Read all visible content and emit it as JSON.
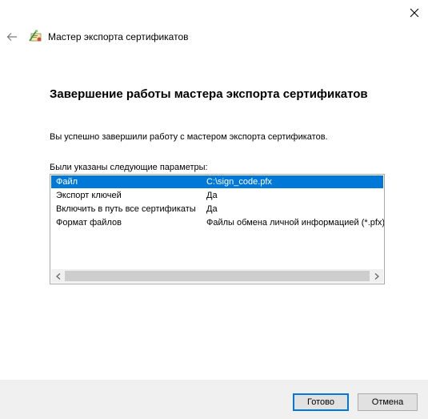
{
  "window": {
    "title": "Мастер экспорта сертификатов"
  },
  "page": {
    "heading": "Завершение работы мастера экспорта сертификатов",
    "success_text": "Вы успешно завершили работу с мастером экспорта сертификатов.",
    "params_label": "Были указаны следующие параметры:"
  },
  "params": [
    {
      "name": "Файл",
      "value": "C:\\sign_code.pfx",
      "selected": true
    },
    {
      "name": "Экспорт ключей",
      "value": "Да"
    },
    {
      "name": "Включить в путь все сертификаты",
      "value": "Да"
    },
    {
      "name": "Формат файлов",
      "value": "Файлы обмена личной информацией (*.pfx)"
    }
  ],
  "buttons": {
    "finish": "Готово",
    "cancel": "Отмена"
  },
  "colors": {
    "selection": "#0078d7",
    "footer": "#f0f0f0"
  },
  "icons": {
    "back": "back-arrow-icon",
    "close": "close-icon",
    "wizard": "certificate-wizard-icon"
  }
}
